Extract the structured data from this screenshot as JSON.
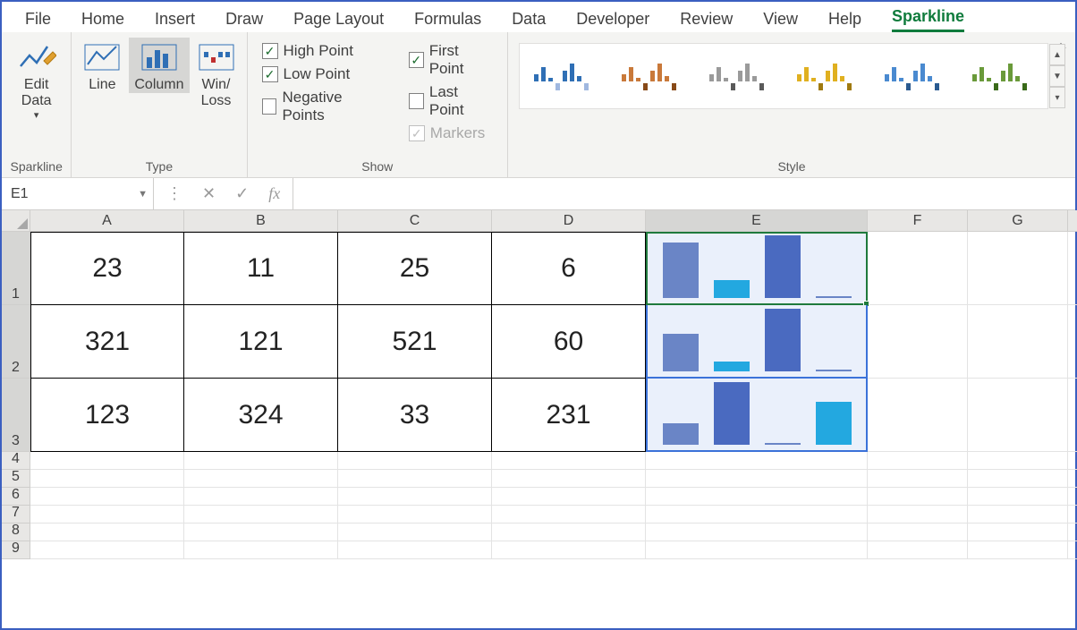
{
  "tabs": {
    "items": [
      "File",
      "Home",
      "Insert",
      "Draw",
      "Page Layout",
      "Formulas",
      "Data",
      "Developer",
      "Review",
      "View",
      "Help",
      "Sparkline"
    ],
    "active": "Sparkline"
  },
  "ribbon": {
    "sparkline_group": {
      "label": "Sparkline",
      "edit_data": "Edit\nData"
    },
    "type_group": {
      "label": "Type",
      "line": "Line",
      "column": "Column",
      "winloss": "Win/\nLoss"
    },
    "show_group": {
      "label": "Show",
      "high": "High Point",
      "low": "Low Point",
      "neg": "Negative Points",
      "first": "First Point",
      "last": "Last Point",
      "markers": "Markers"
    },
    "style_group": {
      "label": "Style"
    }
  },
  "formula_bar": {
    "name_box": "E1",
    "fx": "fx"
  },
  "columns": [
    "A",
    "B",
    "C",
    "D",
    "E",
    "F",
    "G"
  ],
  "rows": [
    "1",
    "2",
    "3",
    "4",
    "5",
    "6",
    "7",
    "8",
    "9"
  ],
  "data": {
    "r1": {
      "A": "23",
      "B": "11",
      "C": "25",
      "D": "6"
    },
    "r2": {
      "A": "321",
      "B": "121",
      "C": "521",
      "D": "60"
    },
    "r3": {
      "A": "123",
      "B": "324",
      "C": "33",
      "D": "231"
    }
  },
  "chart_data": [
    {
      "type": "bar",
      "categories": [
        "A",
        "B",
        "C",
        "D"
      ],
      "values": [
        23,
        11,
        25,
        6
      ],
      "ylim": [
        0,
        25
      ],
      "title": "",
      "xlabel": "",
      "ylabel": ""
    },
    {
      "type": "bar",
      "categories": [
        "A",
        "B",
        "C",
        "D"
      ],
      "values": [
        321,
        121,
        521,
        60
      ],
      "ylim": [
        0,
        521
      ],
      "title": "",
      "xlabel": "",
      "ylabel": ""
    },
    {
      "type": "bar",
      "categories": [
        "A",
        "B",
        "C",
        "D"
      ],
      "values": [
        123,
        324,
        33,
        231
      ],
      "ylim": [
        0,
        324
      ],
      "title": "",
      "xlabel": "",
      "ylabel": ""
    }
  ],
  "selection": {
    "active": "E1",
    "range": "E1:E3"
  }
}
